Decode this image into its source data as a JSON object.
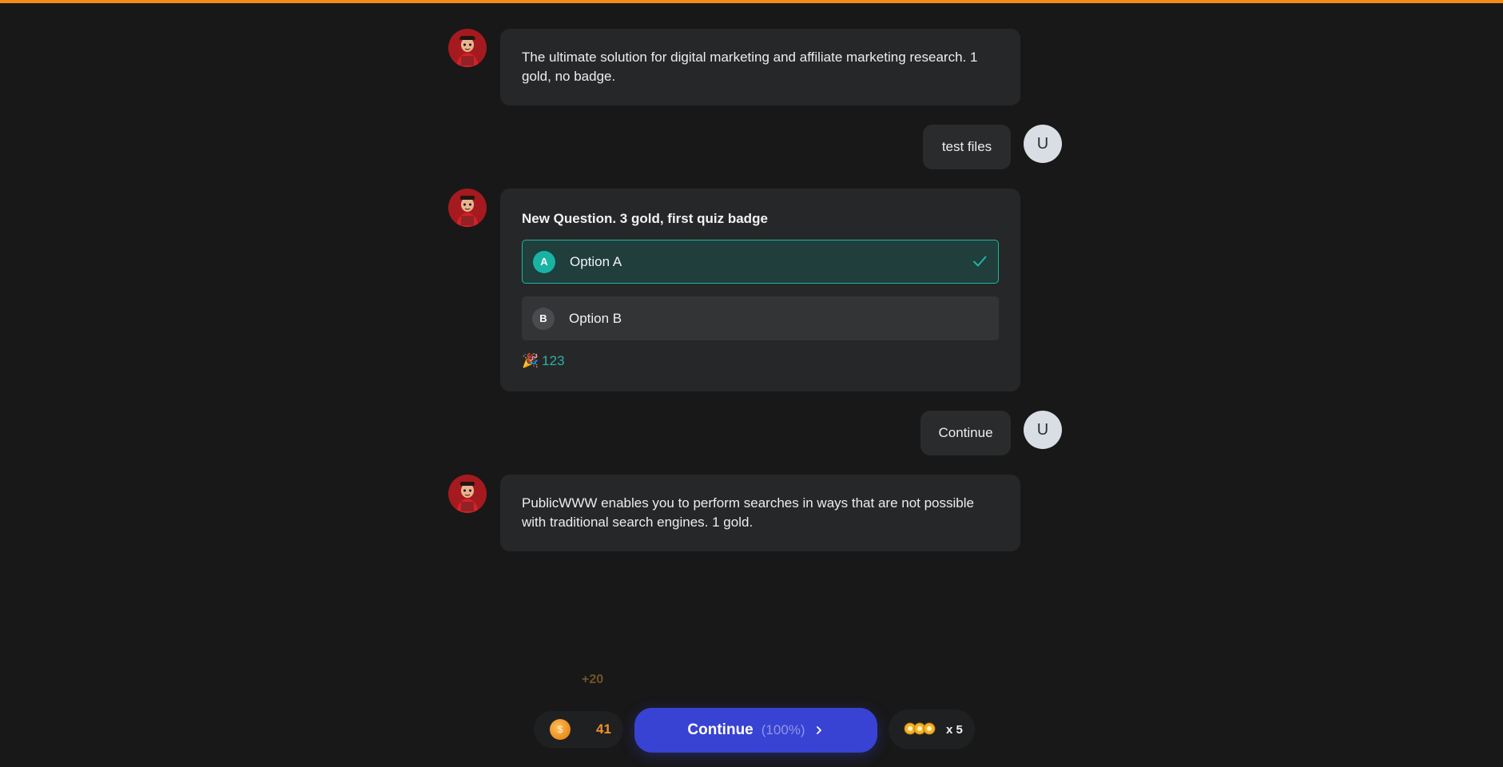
{
  "accent": {
    "top_bar": "#f28b1c",
    "correct": "#19b3a4",
    "button": "#3843d3",
    "gold": "#f2902a"
  },
  "messages": [
    {
      "role": "bot",
      "text": "The ultimate solution for digital marketing and affiliate marketing research. 1 gold, no badge."
    },
    {
      "role": "user",
      "avatar": "U",
      "text": "test files"
    },
    {
      "role": "bot",
      "quiz": {
        "title": "New Question. 3 gold, first quiz badge",
        "options": [
          {
            "letter": "A",
            "label": "Option A",
            "selected": true,
            "icon": "check-icon"
          },
          {
            "letter": "B",
            "label": "Option B",
            "selected": false
          }
        ],
        "reaction": {
          "icon": "party-popper-icon",
          "emoji": "🎉",
          "count": "123"
        }
      }
    },
    {
      "role": "user",
      "avatar": "U",
      "text": "Continue"
    },
    {
      "role": "bot",
      "text": "PublicWWW enables you to perform searches in ways that are not possible with traditional search engines. 1 gold."
    }
  ],
  "footer": {
    "gain": "+20",
    "gold_icon": "coin-icon",
    "gold": "41",
    "continue_label": "Continue",
    "continue_progress": "(100%)",
    "continue_icon": "chevron-right-icon",
    "badge_icon": "badges-icon",
    "badge_multiplier": "x 5"
  }
}
